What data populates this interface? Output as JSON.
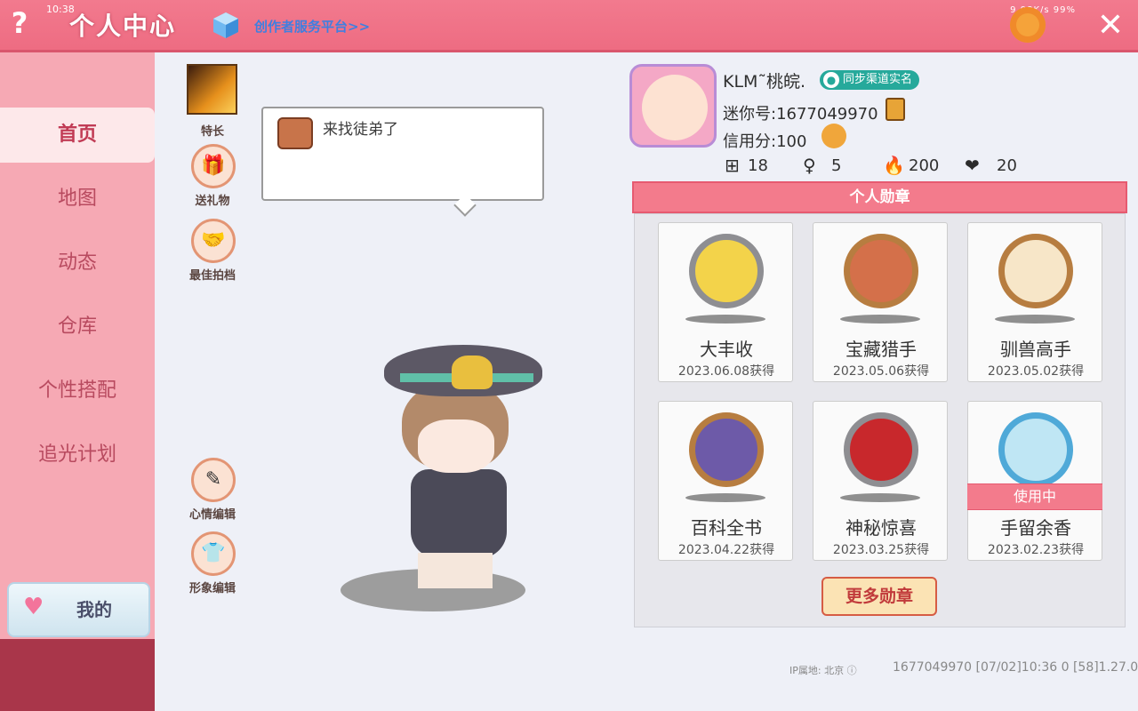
{
  "topbar": {
    "time": "10:38",
    "title": "个人中心",
    "creator_link": "创作者服务平台>>",
    "network_speed": "9.98K/s",
    "battery": "99%",
    "help_glyph": "?",
    "close_glyph": "✕"
  },
  "sidebar": {
    "items": [
      {
        "label": "首页",
        "active": true
      },
      {
        "label": "地图"
      },
      {
        "label": "动态"
      },
      {
        "label": "仓库"
      },
      {
        "label": "个性搭配"
      },
      {
        "label": "追光计划"
      }
    ],
    "mine_label": "我的"
  },
  "actions": {
    "skill": "特长",
    "gift": "送礼物",
    "partner": "最佳拍档",
    "mood": "心情编辑",
    "appearance": "形象编辑"
  },
  "bubble": {
    "text": "来找徒弟了"
  },
  "profile": {
    "username": "KLM˜桃皖.",
    "verify_badge": "同步渠道实名",
    "mini_id": "迷你号:1677049970",
    "credit": "信用分:100",
    "stats": [
      {
        "icon": "plus-square-icon",
        "value": "18"
      },
      {
        "icon": "person-cheer-icon",
        "value": "5"
      },
      {
        "icon": "flame-icon",
        "value": "200"
      },
      {
        "icon": "heart-icon",
        "value": "20"
      }
    ]
  },
  "medals": {
    "header": "个人勋章",
    "items": [
      {
        "name": "大丰收",
        "date": "2023.06.08获得",
        "rim": "silver"
      },
      {
        "name": "宝藏猎手",
        "date": "2023.05.06获得",
        "rim": "bronze"
      },
      {
        "name": "驯兽高手",
        "date": "2023.05.02获得",
        "rim": "bronze"
      },
      {
        "name": "百科全书",
        "date": "2023.04.22获得",
        "rim": "bronze"
      },
      {
        "name": "神秘惊喜",
        "date": "2023.03.25获得",
        "rim": "silver"
      },
      {
        "name": "手留余香",
        "date": "2023.02.23获得",
        "rim": "blue"
      }
    ],
    "in_use_label": "使用中",
    "more_button": "更多勋章"
  },
  "footer": {
    "ip_location": "IP属地: 北京",
    "info": "1677049970    [07/02]10:36 0  [58]1.27.0"
  },
  "colors": {
    "topbar": "#ee6c82",
    "sidebar": "#f6a9b4",
    "accent_pink": "#f37b8c",
    "teal_badge": "#26a99b",
    "link_blue": "#3f7fe0"
  }
}
